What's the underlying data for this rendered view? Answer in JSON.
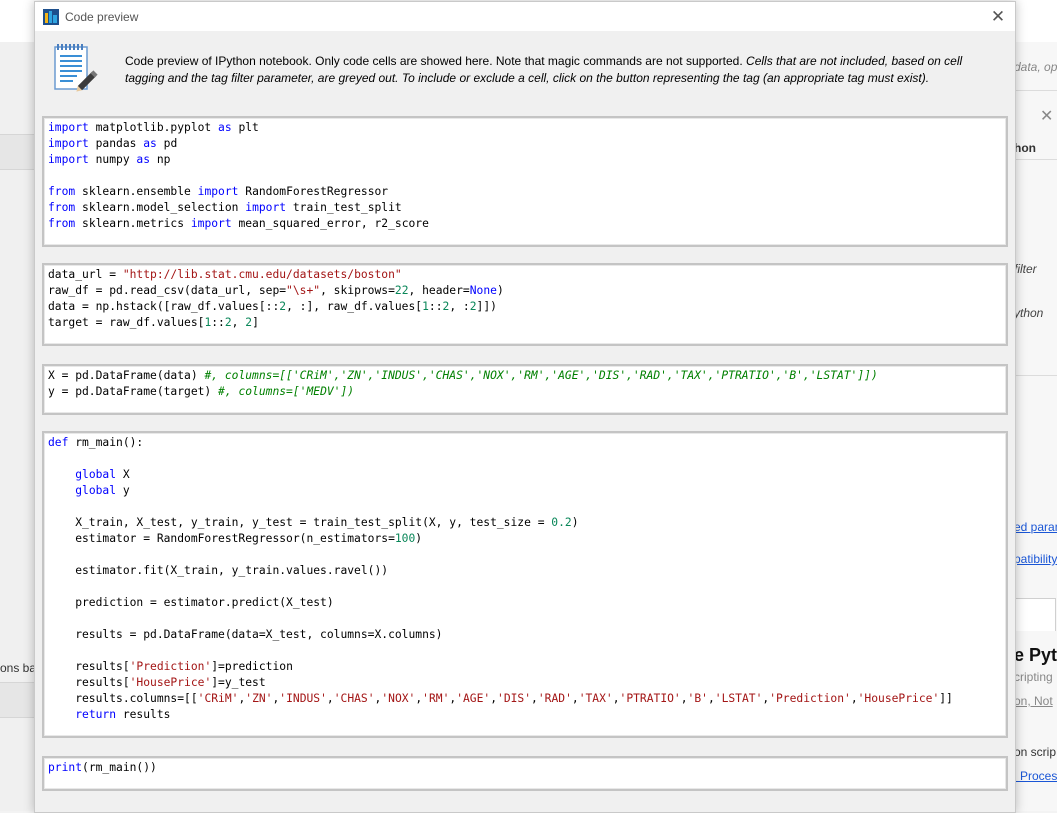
{
  "window": {
    "title": "Code preview"
  },
  "header": {
    "description_plain": "Code preview of IPython notebook. Only code cells are showed here. Note that magic commands are not supported.",
    "description_italic": "Cells that are not included, based on cell tagging and the tag filter parameter, are greyed out. To include or exclude a cell, click on the button representing the tag (an appropriate tag must exist)."
  },
  "background": {
    "left_text": "ons ba",
    "right_texts": [
      "data, ope",
      "hon",
      "filter",
      "ython",
      "ed param",
      "patibility",
      "e Pyt",
      "cripting",
      "on, Not",
      "on scrip",
      "l Proces"
    ]
  },
  "cells": [
    {
      "id": "cell-1",
      "lines": [
        "import matplotlib.pyplot as plt",
        "import pandas as pd",
        "import numpy as np",
        "",
        "from sklearn.ensemble import RandomForestRegressor",
        "from sklearn.model_selection import train_test_split",
        "from sklearn.metrics import mean_squared_error, r2_score"
      ]
    },
    {
      "id": "cell-2",
      "lines": [
        "data_url = \"http://lib.stat.cmu.edu/datasets/boston\"",
        "raw_df = pd.read_csv(data_url, sep=\"\\s+\", skiprows=22, header=None)",
        "data = np.hstack([raw_df.values[::2, :], raw_df.values[1::2, :2]])",
        "target = raw_df.values[1::2, 2]"
      ]
    },
    {
      "id": "cell-3",
      "lines": [
        "X = pd.DataFrame(data) #, columns=[['CRiM','ZN','INDUS','CHAS','NOX','RM','AGE','DIS','RAD','TAX','PTRATIO','B','LSTAT']])",
        "y = pd.DataFrame(target) #, columns=['MEDV'])"
      ]
    },
    {
      "id": "cell-4",
      "lines": [
        "def rm_main():",
        "",
        "    global X",
        "    global y",
        "",
        "    X_train, X_test, y_train, y_test = train_test_split(X, y, test_size = 0.2)",
        "    estimator = RandomForestRegressor(n_estimators=100)",
        "",
        "    estimator.fit(X_train, y_train.values.ravel())",
        "",
        "    prediction = estimator.predict(X_test)",
        "",
        "    results = pd.DataFrame(data=X_test, columns=X.columns)",
        "",
        "    results['Prediction']=prediction",
        "    results['HousePrice']=y_test",
        "    results.columns=[['CRiM','ZN','INDUS','CHAS','NOX','RM','AGE','DIS','RAD','TAX','PTRATIO','B','LSTAT','Prediction','HousePrice']]",
        "    return results"
      ]
    },
    {
      "id": "cell-5",
      "lines": [
        "print(rm_main())"
      ]
    }
  ],
  "colors": {
    "keyword": "#0000ff",
    "string": "#a31515",
    "number": "#098658",
    "comment": "#008000",
    "builtin": "#000080"
  }
}
